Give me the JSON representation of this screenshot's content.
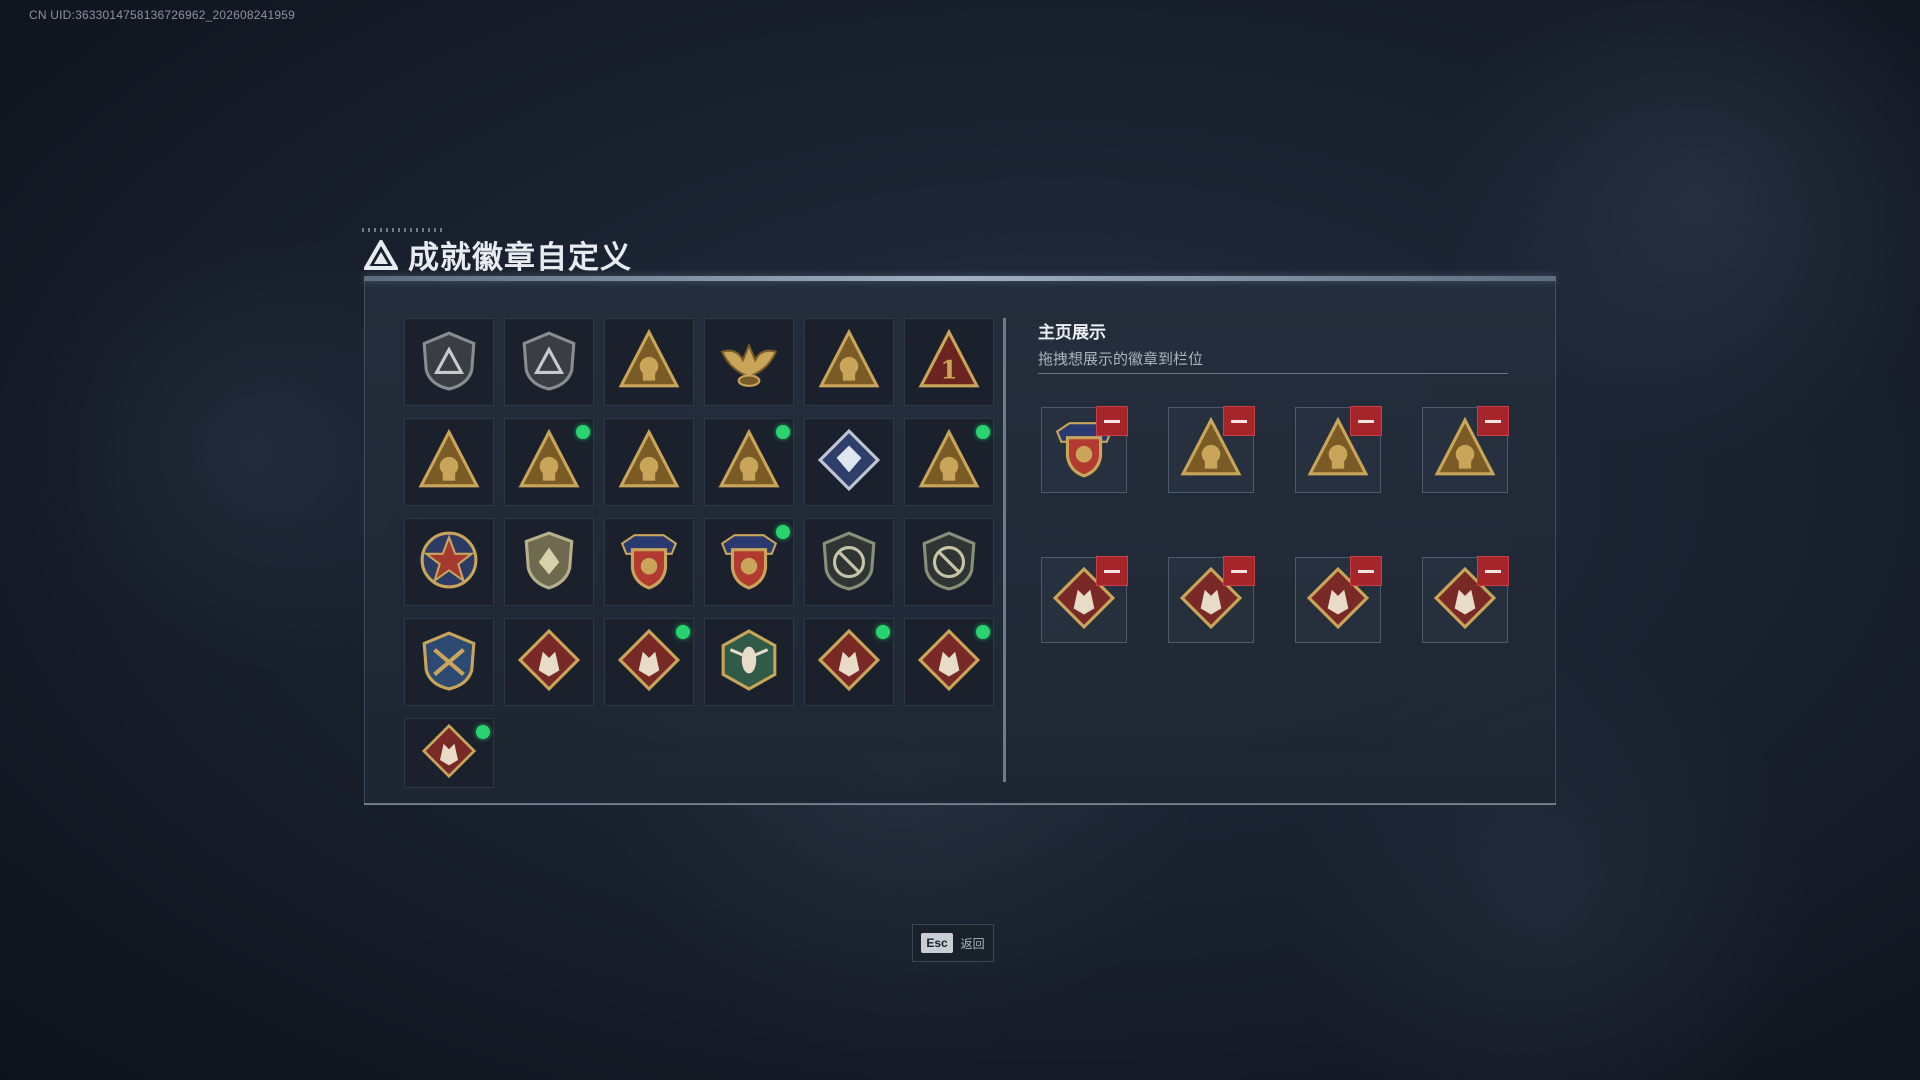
{
  "uid_text": "CN UID:3633014758136726962_202608241959",
  "title": "成就徽章自定义",
  "showcase": {
    "title": "主页展示",
    "subtitle": "拖拽想展示的徽章到栏位"
  },
  "esc": {
    "key": "Esc",
    "label": "返回"
  },
  "badges": [
    {
      "icon": "shield-triangle-icon",
      "kind": "shield-dark",
      "new": false
    },
    {
      "icon": "helicopter-shield-icon",
      "kind": "shield-dark",
      "new": false
    },
    {
      "icon": "triangle-58-icon",
      "kind": "triangle-gold",
      "new": false
    },
    {
      "icon": "eagle-emblem-icon",
      "kind": "eagle-gold",
      "new": false
    },
    {
      "icon": "triangle-bowl-icon",
      "kind": "triangle-gold",
      "new": false
    },
    {
      "icon": "triangle-number-one-icon",
      "kind": "triangle-one",
      "new": false
    },
    {
      "icon": "triangle-soldier-icon",
      "kind": "triangle-gold",
      "new": false
    },
    {
      "icon": "triangle-soldier-icon",
      "kind": "triangle-gold",
      "new": true
    },
    {
      "icon": "triangle-soldier-icon",
      "kind": "triangle-gold",
      "new": false
    },
    {
      "icon": "triangle-rocket-icon",
      "kind": "triangle-gold",
      "new": true
    },
    {
      "icon": "crystal-diamond-icon",
      "kind": "diamond-blue",
      "new": false
    },
    {
      "icon": "triangle-flamethrower-icon",
      "kind": "triangle-gold",
      "new": true
    },
    {
      "icon": "star-medal-icon",
      "kind": "star-medal",
      "new": false
    },
    {
      "icon": "shield-emblem-icon",
      "kind": "shield-olive",
      "new": false
    },
    {
      "icon": "winged-shield-icon",
      "kind": "winged-red",
      "new": false
    },
    {
      "icon": "winged-shield-icon",
      "kind": "winged-red",
      "new": true
    },
    {
      "icon": "no-rifle-shield-icon",
      "kind": "shield-noweapon",
      "new": false
    },
    {
      "icon": "no-rifle-shield-icon",
      "kind": "shield-noweapon",
      "new": false
    },
    {
      "icon": "crossed-guns-shield-icon",
      "kind": "shield-blue",
      "new": false
    },
    {
      "icon": "wolf-diamond-icon",
      "kind": "diamond-red",
      "new": false
    },
    {
      "icon": "wolf-diamond-icon",
      "kind": "diamond-red",
      "new": true
    },
    {
      "icon": "hornet-hexagon-icon",
      "kind": "hex-green",
      "new": false
    },
    {
      "icon": "dragon-diamond-icon",
      "kind": "diamond-red",
      "new": true
    },
    {
      "icon": "horse-diamond-icon",
      "kind": "diamond-red",
      "new": true
    },
    {
      "icon": "snake-sword-diamond-icon",
      "kind": "diamond-red",
      "new": true
    }
  ],
  "slots": [
    {
      "icon": "winged-shield-icon",
      "kind": "winged-red"
    },
    {
      "icon": "triangle-soldier-icon",
      "kind": "triangle-gold"
    },
    {
      "icon": "triangle-flamethrower-icon",
      "kind": "triangle-gold"
    },
    {
      "icon": "triangle-rocket-icon",
      "kind": "triangle-gold"
    },
    {
      "icon": "wolf-diamond-icon",
      "kind": "diamond-red"
    },
    {
      "icon": "dragon-diamond-icon",
      "kind": "diamond-red"
    },
    {
      "icon": "horse-diamond-icon",
      "kind": "diamond-red"
    },
    {
      "icon": "snake-sword-diamond-icon",
      "kind": "diamond-red"
    }
  ],
  "colors": {
    "gold": "#c9a55a",
    "gold_dark": "#7a5a25",
    "red_badge": "#7a2a26",
    "new_dot": "#29d46f",
    "remove": "#a6252a"
  }
}
